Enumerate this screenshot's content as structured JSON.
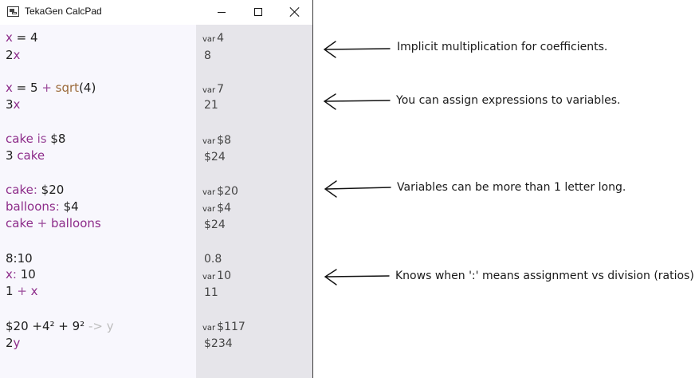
{
  "window": {
    "title": "TekaGen CalcPad",
    "controls": {
      "minimize": "minimize",
      "maximize": "maximize",
      "close": "close"
    }
  },
  "editor": {
    "lines": [
      {
        "parts": [
          "x",
          " = 4"
        ]
      },
      {
        "parts": [
          "2",
          "x"
        ]
      },
      {
        "parts": [
          "x",
          " = 5 ",
          "+",
          " ",
          "sqrt",
          "(4)"
        ]
      },
      {
        "parts": [
          "3",
          "x"
        ]
      },
      {
        "parts": [
          "cake",
          " is ",
          "$8"
        ]
      },
      {
        "parts": [
          "3 ",
          "cake"
        ]
      },
      {
        "parts": [
          "cake",
          ": ",
          "$20"
        ]
      },
      {
        "parts": [
          "balloons",
          ": ",
          "$4"
        ]
      },
      {
        "parts": [
          "cake",
          " ",
          "+",
          " ",
          "balloons"
        ]
      },
      {
        "parts": [
          "8:10"
        ]
      },
      {
        "parts": [
          "x",
          ": ",
          "10"
        ]
      },
      {
        "parts": [
          "1 ",
          "+",
          " ",
          "x"
        ]
      },
      {
        "parts": [
          "$20 +4² + 9² ",
          "->",
          " ",
          "y"
        ]
      },
      {
        "parts": [
          "2",
          "y"
        ]
      }
    ]
  },
  "results": [
    {
      "tag": "var",
      "value": "4"
    },
    {
      "tag": "",
      "value": "8"
    },
    {
      "tag": "var",
      "value": "7"
    },
    {
      "tag": "",
      "value": "21"
    },
    {
      "tag": "var",
      "value": "$8"
    },
    {
      "tag": "",
      "value": "$24"
    },
    {
      "tag": "var",
      "value": "$20"
    },
    {
      "tag": "var",
      "value": "$4"
    },
    {
      "tag": "",
      "value": "$24"
    },
    {
      "tag": "",
      "value": "0.8"
    },
    {
      "tag": "var",
      "value": "10"
    },
    {
      "tag": "",
      "value": "11"
    },
    {
      "tag": "var",
      "value": "$117"
    },
    {
      "tag": "",
      "value": "$234"
    }
  ],
  "annotations": [
    "Implicit multiplication for coefficients.",
    "You can assign expressions to variables.",
    "Variables can be more than 1 letter long.",
    "Knows when ':' means assignment vs division (ratios)."
  ],
  "colors": {
    "variable": "#8d2c8a",
    "operator": "#9a4a9a",
    "function": "#9b6a3a",
    "dimmed": "#bdbdbd",
    "editor_bg": "#f8f7fd",
    "results_bg": "#e6e5ea"
  }
}
